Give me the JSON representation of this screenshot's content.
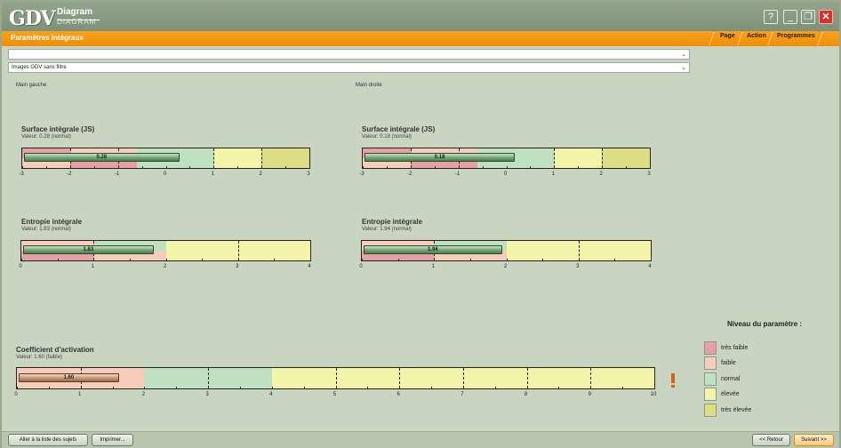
{
  "titlebar": {
    "logo": "GDV",
    "app_name": "Diagram",
    "app_sub": "DIAGRAM"
  },
  "colors": {
    "tres_faible": "#e6a0a3",
    "faible": "#f6cdbb",
    "normal": "#bfe1c1",
    "elevee": "#f4f5a8",
    "tres_elevee": "#dddd84",
    "accent": "#f39a12"
  },
  "header": {
    "title": "Paramètres intégraux",
    "menu": [
      "Page",
      "Action",
      "Programmes"
    ]
  },
  "selects": {
    "first": "",
    "second": "Images GDV sans filtre"
  },
  "panels": {
    "left_label": "Main gauche",
    "right_label": "Main droite"
  },
  "gauges": {
    "surface_left": {
      "title": "Surface intégrale (JS)",
      "value_text": "Valeur: 0.28 (normal)",
      "bar_label": "0.28",
      "value": 0.28,
      "ticks": [
        "-3",
        "-2",
        "-1",
        "0",
        "1",
        "2",
        "3"
      ]
    },
    "surface_right": {
      "title": "Surface intégrale (JS)",
      "value_text": "Valeur: 0.18 (normal)",
      "bar_label": "0.18",
      "value": 0.18,
      "ticks": [
        "-3",
        "-2",
        "-1",
        "0",
        "1",
        "2",
        "3"
      ]
    },
    "entropie_left": {
      "title": "Entropie intégrale",
      "value_text": "Valeur: 1.83 (normal)",
      "bar_label": "1.83",
      "value": 1.83,
      "ticks": [
        "0",
        "1",
        "2",
        "3",
        "4"
      ]
    },
    "entropie_right": {
      "title": "Entropie intégrale",
      "value_text": "Valeur: 1.94 (normal)",
      "bar_label": "1.94",
      "value": 1.94,
      "ticks": [
        "0",
        "1",
        "2",
        "3",
        "4"
      ]
    },
    "activation": {
      "title": "Coefficient d'activation",
      "value_text": "Valeur: 1.60 (faible)",
      "bar_label": "1.60",
      "value": 1.6,
      "ticks": [
        "0",
        "1",
        "2",
        "3",
        "4",
        "5",
        "6",
        "7",
        "8",
        "9",
        "10"
      ]
    }
  },
  "legend": {
    "title": "Niveau du paramètre :",
    "items": [
      "très faible",
      "faible",
      "normal",
      "élevée",
      "très élevée"
    ]
  },
  "buttons": {
    "subjects": "Aller à la liste des sujets",
    "print": "Imprimer...",
    "back": "<< Retour",
    "next": "Suivant >>"
  }
}
